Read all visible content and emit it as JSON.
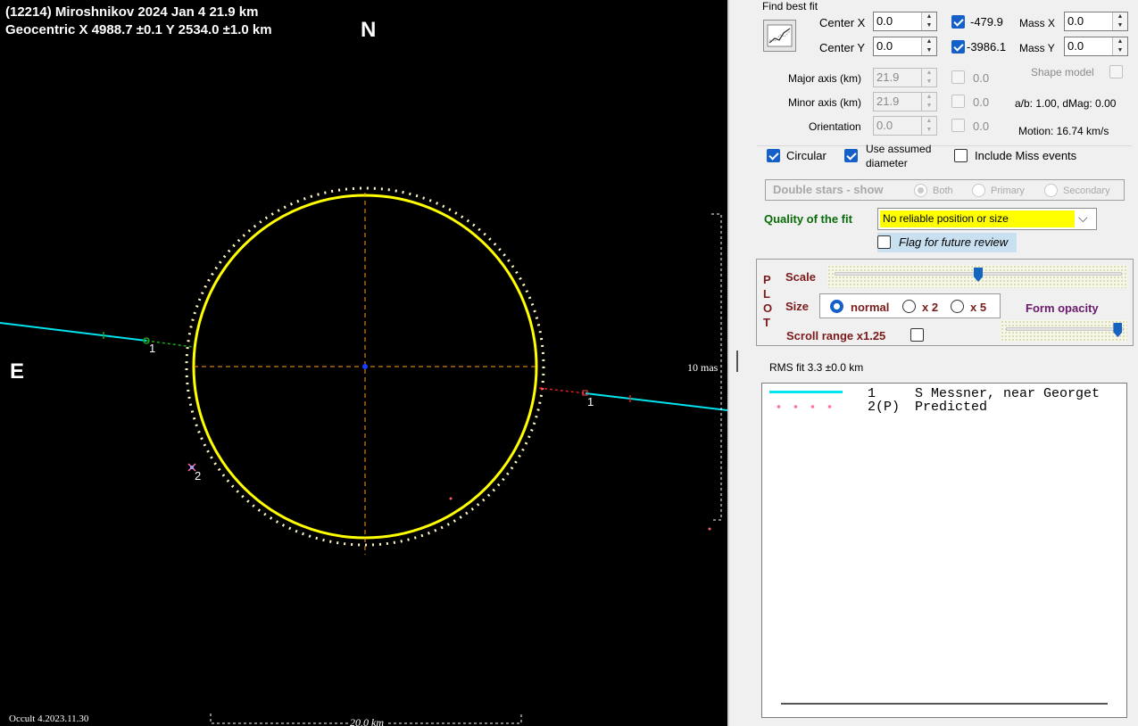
{
  "plot": {
    "title_line1": "(12214) Miroshnikov  2024 Jan 4   21.9 km",
    "title_line2": "Geocentric  X  4988.7 ±0.1  Y 2534.0 ±1.0 km",
    "north_label": "N",
    "east_label": "E",
    "chord_labels": [
      "1",
      "2",
      "1"
    ],
    "scale_bar_label": "20.0 km",
    "mas_label": "10 mas",
    "version": "Occult 4.2023.11.30",
    "colors": {
      "fit_ellipse": "#ffff00",
      "chord": "#00e5ee",
      "axes": "#ff9c1a",
      "predicted": "#ff6fb0"
    }
  },
  "panel": {
    "find_best_fit_title": "Find best fit",
    "fit_button_icon": "fit-curve-icon",
    "center_x": {
      "label": "Center X",
      "value": "0.0",
      "checked": true,
      "fitted": "-479.9"
    },
    "center_y": {
      "label": "Center Y",
      "value": "0.0",
      "checked": true,
      "fitted": "-3986.1"
    },
    "mass_x": {
      "label": "Mass X",
      "value": "0.0"
    },
    "mass_y": {
      "label": "Mass Y",
      "value": "0.0"
    },
    "major_axis": {
      "label": "Major axis (km)",
      "value": "21.9",
      "fitted": "0.0"
    },
    "minor_axis": {
      "label": "Minor axis (km)",
      "value": "21.9",
      "fitted": "0.0"
    },
    "orientation": {
      "label": "Orientation",
      "value": "0.0",
      "fitted": "0.0"
    },
    "shape_model_label": "Shape model",
    "ab_text": "a/b: 1.00, dMag: 0.00",
    "motion_text": "Motion: 16.74 km/s",
    "circular_label": "Circular",
    "use_assumed_label1": "Use assumed",
    "use_assumed_label2": "diameter",
    "include_miss_label": "Include Miss events",
    "double_stars_label": "Double stars - show",
    "ds_options": [
      "Both",
      "Primary",
      "Secondary"
    ],
    "quality_label": "Quality of the fit",
    "quality_value": "No reliable position or size",
    "flag_label": "Flag for future review",
    "plot_letters": [
      "P",
      "L",
      "O",
      "T"
    ],
    "scale_label": "Scale",
    "scale_level": 0.5,
    "size_label": "Size",
    "size_options": [
      "normal",
      "x 2",
      "x 5"
    ],
    "form_opacity_label": "Form opacity",
    "opacity_level": 0.95,
    "scroll_range_label": "Scroll range x1.25",
    "rms_label": "RMS fit 3.3 ±0.0 km",
    "legend": [
      {
        "num": "1",
        "name": "S Messner, near Georget",
        "style": "solid",
        "color": "#00e5ee"
      },
      {
        "num": "2(P)",
        "name": "Predicted",
        "style": "dotted",
        "color": "#ff6fb0"
      }
    ]
  }
}
